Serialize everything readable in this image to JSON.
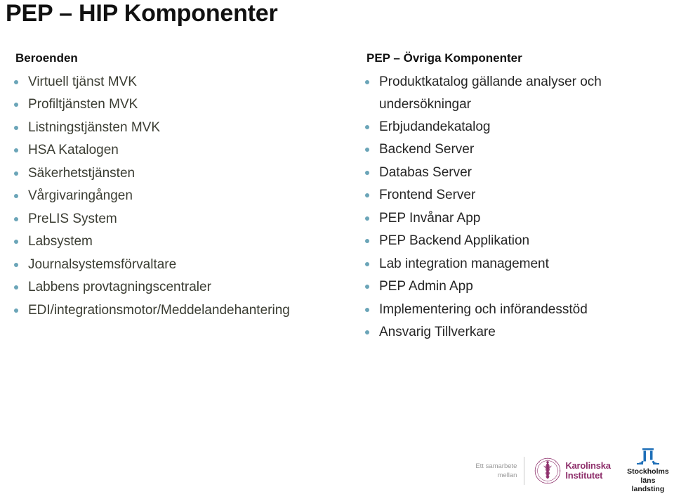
{
  "slide": {
    "title": "PEP – HIP Komponenter",
    "background_color": "#ffffff"
  },
  "left_column": {
    "heading": "Beroenden",
    "bullet_color": "#6ba5b8",
    "text_color": "#3b3d33",
    "items": [
      "Virtuell tjänst MVK",
      "Profiltjänsten MVK",
      "Listningstjänsten MVK",
      "HSA Katalogen",
      "Säkerhetstjänsten",
      "Vårgivaringången",
      "PreLIS System",
      "Labsystem",
      "Journalsystemsförvaltare",
      "Labbens provtagningscentraler",
      "EDI/integrationsmotor/Meddelandehantering"
    ]
  },
  "right_column": {
    "heading": "PEP – Övriga Komponenter",
    "bullet_color": "#6ba5b8",
    "text_color": "#262626",
    "items": [
      "Produktkatalog gällande analyser och undersökningar",
      "Erbjudandekatalog",
      "Backend Server",
      "Databas Server",
      "Frontend Server",
      "PEP Invånar App",
      "PEP Backend Applikation",
      "Lab integration management",
      "PEP Admin App",
      "Implementering och införandesstöd",
      "Ansvarig Tillverkare"
    ]
  },
  "footer": {
    "caption_line1": "Ett samarbete",
    "caption_line2": "mellan",
    "caption_color": "#9a9a9a",
    "logos": [
      {
        "name": "karolinska-institutet",
        "line1": "Karolinska",
        "line2": "Institutet",
        "color": "#8e2f6b"
      },
      {
        "name": "stockholms-lans-landsting",
        "line1": "Stockholms läns",
        "line2": "landsting",
        "color": "#1a1a1a",
        "mark_color": "#1e6fb8"
      }
    ]
  }
}
